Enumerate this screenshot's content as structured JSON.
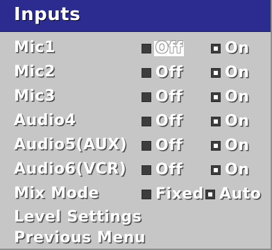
{
  "menu": {
    "title": "Inputs",
    "rows": [
      {
        "label": "Mic1",
        "opt1": "Off",
        "opt2": "On",
        "selected": "Off"
      },
      {
        "label": "Mic2",
        "opt1": "Off",
        "opt2": "On",
        "selected": "On"
      },
      {
        "label": "Mic3",
        "opt1": "Off",
        "opt2": "On",
        "selected": "On"
      },
      {
        "label": "Audio4",
        "opt1": "Off",
        "opt2": "On",
        "selected": "On"
      },
      {
        "label": "Audio5(AUX)",
        "opt1": "Off",
        "opt2": "On",
        "selected": "On"
      },
      {
        "label": "Audio6(VCR)",
        "opt1": "Off",
        "opt2": "On",
        "selected": "On"
      },
      {
        "label": "Mix Mode",
        "opt1": "Fixed",
        "opt2": "Auto",
        "selected": "Auto"
      }
    ],
    "links": [
      {
        "label": "Level Settings"
      },
      {
        "label": "Previous Menu"
      }
    ]
  },
  "colors": {
    "background": "#c5c6c5",
    "titlebar": "#2c2c90",
    "text": "#ffffff"
  }
}
